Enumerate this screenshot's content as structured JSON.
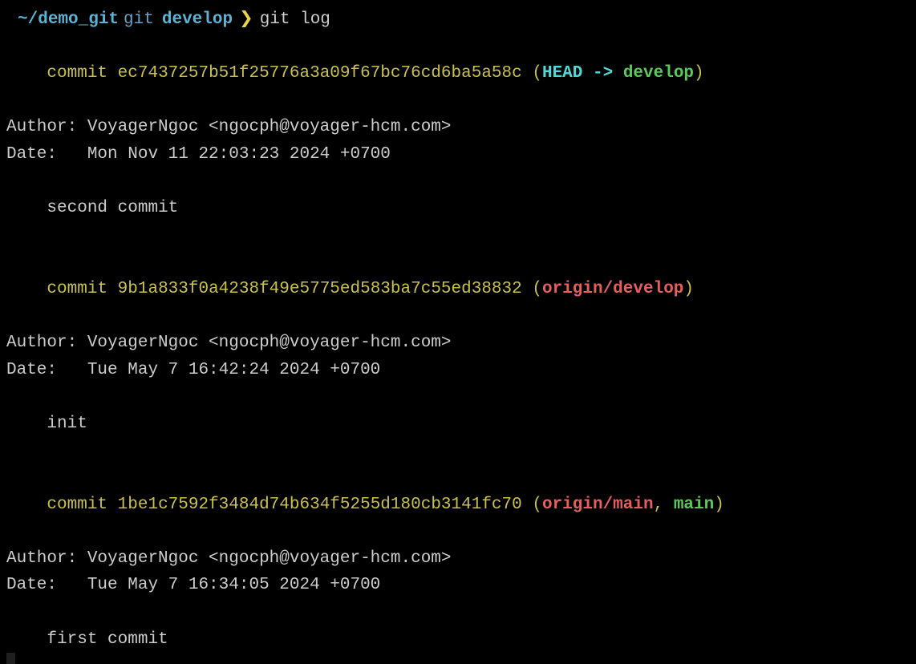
{
  "prompt": {
    "apple_glyph": "",
    "folder_glyph": "",
    "path_tilde": "~/",
    "path_name": "demo_git",
    "git_label": "git",
    "branch_glyph": "",
    "branch_name": "develop",
    "prompt_arrow": "❯",
    "command": "git log"
  },
  "commits": [
    {
      "commit_word": "commit",
      "hash": "ec7437257b51f25776a3a09f67bc76cd6ba5a58c",
      "refs": {
        "open_paren": "(",
        "head": "HEAD",
        "arrow": " -> ",
        "local": "develop",
        "close_paren": ")"
      },
      "author_label": "Author:",
      "author_value": "VoyagerNgoc <ngocph@voyager-hcm.com>",
      "date_label": "Date:",
      "date_value": "Mon Nov 11 22:03:23 2024 +0700",
      "message": "second commit"
    },
    {
      "commit_word": "commit",
      "hash": "9b1a833f0a4238f49e5775ed583ba7c55ed38832",
      "refs": {
        "open_paren": "(",
        "remote": "origin/develop",
        "close_paren": ")"
      },
      "author_label": "Author:",
      "author_value": "VoyagerNgoc <ngocph@voyager-hcm.com>",
      "date_label": "Date:",
      "date_value": "Tue May 7 16:42:24 2024 +0700",
      "message": "init"
    },
    {
      "commit_word": "commit",
      "hash": "1be1c7592f3484d74b634f5255d180cb3141fc70",
      "refs": {
        "open_paren": "(",
        "remote": "origin/main",
        "comma": ", ",
        "local": "main",
        "close_paren": ")"
      },
      "author_label": "Author:",
      "author_value": "VoyagerNgoc <ngocph@voyager-hcm.com>",
      "date_label": "Date:",
      "date_value": "Tue May 7 16:34:05 2024 +0700",
      "message": "first commit"
    }
  ]
}
